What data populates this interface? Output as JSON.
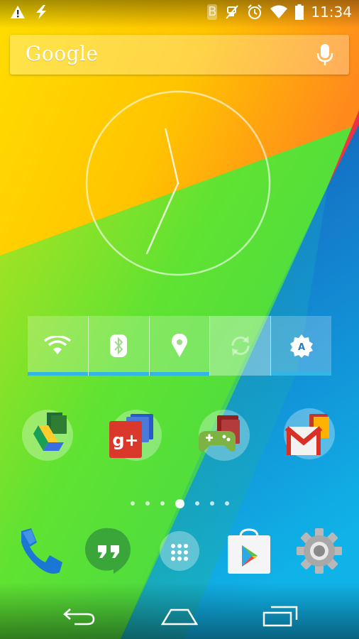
{
  "status_bar": {
    "time": "11:34",
    "bluetooth_glyph": "B",
    "left_icons": [
      "warning-icon",
      "flash-icon"
    ],
    "right_icons": [
      "bluetooth-icon",
      "mute-icon",
      "alarm-icon",
      "wifi-icon",
      "battery-icon"
    ]
  },
  "search_bar": {
    "logo_text": "Google",
    "icon": "mic-icon"
  },
  "clock_widget": {
    "type": "analog-clock",
    "hour": 11,
    "minute": 34
  },
  "power_widget": {
    "buttons": [
      {
        "name": "wifi",
        "icon": "wifi-icon",
        "state": "on"
      },
      {
        "name": "bluetooth",
        "icon": "bluetooth-icon",
        "state": "on"
      },
      {
        "name": "location",
        "icon": "location-pin-icon",
        "state": "on"
      },
      {
        "name": "sync",
        "icon": "sync-icon",
        "state": "off"
      },
      {
        "name": "auto-brightness",
        "icon": "brightness-auto-icon",
        "state": "on"
      }
    ]
  },
  "home_folders": [
    {
      "name": "drive-folder",
      "icon": "google-drive-icon"
    },
    {
      "name": "google-plus-folder",
      "icon": "google-plus-icon"
    },
    {
      "name": "games-folder",
      "icon": "play-games-icon"
    },
    {
      "name": "gmail-folder",
      "icon": "gmail-icon"
    }
  ],
  "page_indicator": {
    "count": 7,
    "active_index": 3
  },
  "dock": [
    {
      "name": "phone",
      "icon": "phone-icon"
    },
    {
      "name": "hangouts",
      "icon": "hangouts-icon"
    },
    {
      "name": "app-drawer",
      "icon": "app-drawer-icon"
    },
    {
      "name": "play-store",
      "icon": "play-store-icon"
    },
    {
      "name": "settings",
      "icon": "settings-gear-icon"
    }
  ],
  "nav_bar": [
    "back-icon",
    "home-icon",
    "recents-icon"
  ],
  "colors": {
    "wallpaper_yellow": "#ffd200",
    "wallpaper_orange": "#ff8c1a",
    "wallpaper_green": "#5fe032",
    "wallpaper_blue": "#0aa0e6",
    "wallpaper_magenta": "#e0245e",
    "power_indicator": "#33b5e5"
  }
}
